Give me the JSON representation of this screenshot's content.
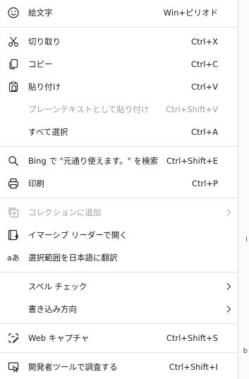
{
  "menu": {
    "emoji": {
      "label": "絵文字",
      "shortcut": "Win+ピリオド",
      "icon": "smiley-icon"
    },
    "cut": {
      "label": "切り取り",
      "shortcut": "Ctrl+X",
      "icon": "scissors-icon"
    },
    "copy": {
      "label": "コピー",
      "shortcut": "Ctrl+C",
      "icon": "copy-icon"
    },
    "paste": {
      "label": "貼り付け",
      "shortcut": "Ctrl+V",
      "icon": "clipboard-icon"
    },
    "paste_plain": {
      "label": "プレーンテキストとして貼り付け",
      "shortcut": "Ctrl+Shift+V"
    },
    "select_all": {
      "label": "すべて選択",
      "shortcut": "Ctrl+A"
    },
    "bing_search": {
      "label": "Bing で \"元通り使えます。\" を検索",
      "shortcut": "Ctrl+Shift+E",
      "icon": "search-icon"
    },
    "print": {
      "label": "印刷",
      "shortcut": "Ctrl+P",
      "icon": "printer-icon"
    },
    "add_collection": {
      "label": "コレクションに追加",
      "icon": "collections-add-icon"
    },
    "immersive_reader": {
      "label": "イマーシブ リーダーで開く",
      "icon": "immersive-reader-icon"
    },
    "translate": {
      "label": "選択範囲を日本語に翻訳",
      "icon": "translate-icon"
    },
    "spell_check": {
      "label": "スペル チェック"
    },
    "writing_direction": {
      "label": "書き込み方向"
    },
    "web_capture": {
      "label": "Web キャプチャ",
      "shortcut": "Ctrl+Shift+S",
      "icon": "web-capture-icon"
    },
    "devtools": {
      "label": "開発者ツールで調査する",
      "shortcut": "Ctrl+Shift+I",
      "icon": "devtools-icon"
    }
  },
  "colors": {
    "disabled": "#9b9b9b",
    "separator": "#e3e3e3",
    "background": "#ffffff"
  }
}
